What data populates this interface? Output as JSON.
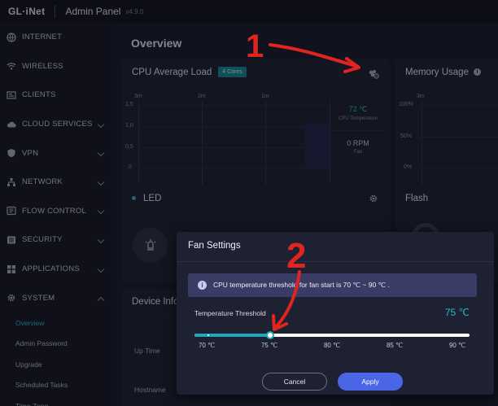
{
  "topbar": {
    "logo": "GL·iNet",
    "title": "Admin Panel",
    "version": "v4.9.0"
  },
  "sidebar": {
    "items": [
      {
        "label": "INTERNET",
        "icon": "globe-icon",
        "has_children": false
      },
      {
        "label": "WIRELESS",
        "icon": "wifi-icon",
        "has_children": false
      },
      {
        "label": "CLIENTS",
        "icon": "clients-icon",
        "has_children": false
      },
      {
        "label": "CLOUD SERVICES",
        "icon": "cloud-icon",
        "has_children": true
      },
      {
        "label": "VPN",
        "icon": "shield-icon",
        "has_children": true
      },
      {
        "label": "NETWORK",
        "icon": "network-icon",
        "has_children": true
      },
      {
        "label": "FLOW CONTROL",
        "icon": "flow-icon",
        "has_children": true
      },
      {
        "label": "SECURITY",
        "icon": "security-icon",
        "has_children": true
      },
      {
        "label": "APPLICATIONS",
        "icon": "apps-icon",
        "has_children": true
      },
      {
        "label": "SYSTEM",
        "icon": "gear-icon",
        "has_children": true,
        "expanded": true
      }
    ],
    "system_sub": [
      {
        "label": "Overview",
        "active": true
      },
      {
        "label": "Admin Password"
      },
      {
        "label": "Upgrade"
      },
      {
        "label": "Scheduled Tasks"
      },
      {
        "label": "Time Zone"
      }
    ]
  },
  "main": {
    "page_title": "Overview",
    "cpu_card": {
      "title": "CPU Average Load",
      "badge": "4 Cores",
      "time_labels": [
        "3m",
        "2m",
        "1m"
      ],
      "y_labels": [
        "1,5",
        "1,0",
        "0,5",
        "0"
      ],
      "temperature": "72 ℃",
      "temperature_label": "CPU Temperature",
      "fan": "0 RPM",
      "fan_label": "Fan"
    },
    "memory_card": {
      "title": "Memory Usage",
      "time_label": "3m",
      "y_labels": [
        "100%",
        "50%",
        "0%"
      ]
    },
    "led_card": {
      "title": "LED"
    },
    "flash_card": {
      "title": "Flash"
    },
    "device_card": {
      "title": "Device Info",
      "rows": [
        "Up Time",
        "Hostname"
      ]
    }
  },
  "modal": {
    "title": "Fan Settings",
    "info": "CPU temperature threshold for fan start is 70 ℃ ~ 90 ℃ .",
    "threshold_label": "Temperature Threshold",
    "threshold_value": "75 ℃",
    "slider_fraction": 0.275,
    "ticks": [
      "70 ℃",
      "75 ℃",
      "80 ℃",
      "85 ℃",
      "90 ℃"
    ],
    "cancel": "Cancel",
    "apply": "Apply"
  },
  "annotations": [
    "1",
    "2"
  ],
  "colors": {
    "accent": "#28b9cb",
    "apply": "#4a66e6",
    "annotation": "#e0241f"
  }
}
